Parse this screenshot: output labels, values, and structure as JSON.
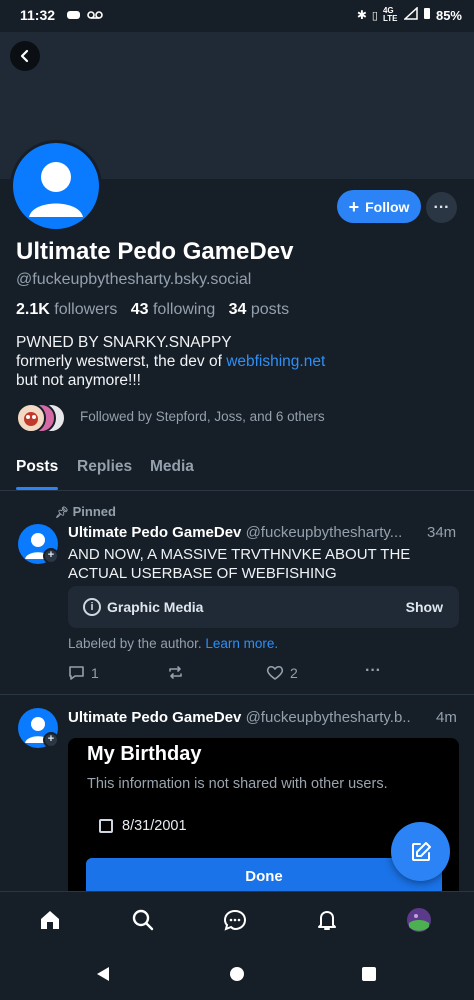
{
  "status_bar": {
    "time": "11:32",
    "network": "4G LTE",
    "battery": "85%"
  },
  "profile": {
    "display_name": "Ultimate Pedo GameDev",
    "handle": "@fuckeupbythesharty.bsky.social",
    "follow_label": "Follow",
    "stats": {
      "followers_count": "2.1K",
      "followers_label": "followers",
      "following_count": "43",
      "following_label": "following",
      "posts_count": "34",
      "posts_label": "posts"
    },
    "bio": {
      "line1": "PWNED BY SNARKY.SNAPPY",
      "line2_prefix": "formerly westwerst, the dev of ",
      "line2_link": "webfishing.net",
      "line3": "but not anymore!!!"
    },
    "followed_by": "Followed by Stepford, Joss, and 6 others"
  },
  "tabs": [
    {
      "label": "Posts",
      "active": true
    },
    {
      "label": "Replies",
      "active": false
    },
    {
      "label": "Media",
      "active": false
    }
  ],
  "posts": [
    {
      "pinned_label": "Pinned",
      "author": "Ultimate Pedo GameDev",
      "handle": "@fuckeupbythesharty...",
      "time": "34m",
      "text": "AND NOW, A MASSIVE TRVTHNVKE ABOUT THE ACTUAL USERBASE OF WEBFISHING",
      "content_warning": {
        "label": "Graphic Media",
        "action": "Show"
      },
      "labeled_text": "Labeled by the author.",
      "learn_more": "Learn more.",
      "reply_count": "1",
      "like_count": "2"
    },
    {
      "author": "Ultimate Pedo GameDev",
      "handle": "@fuckeupbythesharty.b..",
      "time": "4m",
      "image": {
        "title": "My Birthday",
        "subtitle": "This information is not shared with other users.",
        "date": "8/31/2001",
        "button": "Done"
      }
    }
  ],
  "colors": {
    "background": "#161e27",
    "accent": "#2b83f6",
    "muted_text": "#93a0ad"
  }
}
